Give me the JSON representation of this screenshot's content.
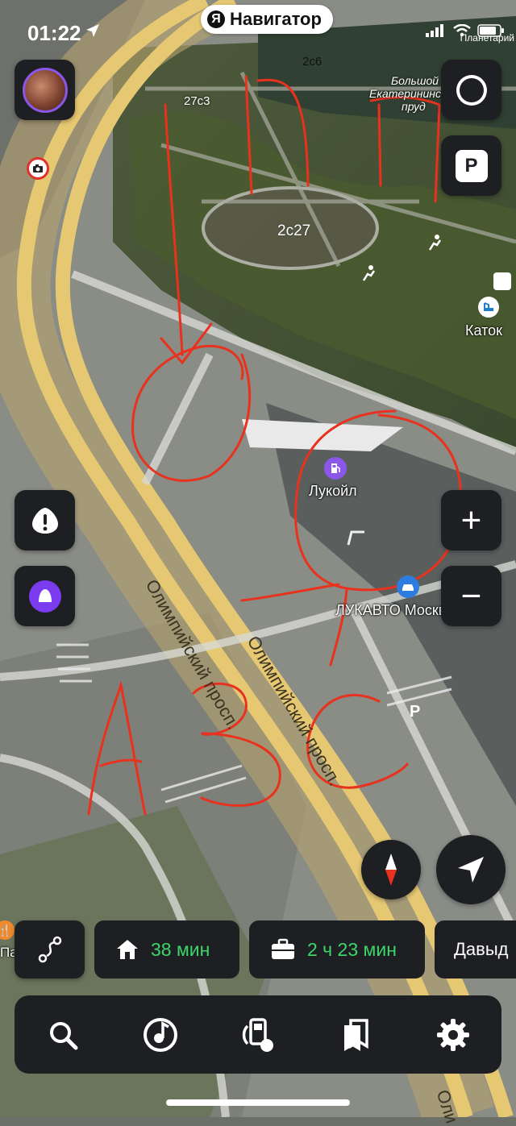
{
  "status_bar": {
    "time": "01:22",
    "carrier": "Планетарий"
  },
  "app": {
    "logo_letter": "Я",
    "title": "Навигатор"
  },
  "map": {
    "labels": {
      "building_27c3": "27с3",
      "building_2c6": "2с6",
      "building_2c27": "2с27",
      "pond_line1": "Большой",
      "pond_line2": "Екатерининс",
      "pond_line3": "пруд",
      "rink": "Каток",
      "gas_station": "Лукойл",
      "car_service": "ЛУКАВТО Москвич",
      "road_1": "Олимпийский просп.",
      "road_2": "Олимпийский просп.",
      "road_bottom": "Оли",
      "left_edge_poi": "Пате"
    },
    "annotations": {
      "letters": [
        "A",
        "B",
        "C"
      ],
      "color": "#e8321e"
    }
  },
  "controls": {
    "zoom_in": "+",
    "zoom_out": "−",
    "parking": "P"
  },
  "shortcuts": [
    {
      "icon": "home-icon",
      "time": "38 мин"
    },
    {
      "icon": "briefcase-icon",
      "time": "2 ч 23 мин"
    },
    {
      "name": "Давыд"
    }
  ],
  "tabbar": [
    "search-icon",
    "music-icon",
    "fuel-icon",
    "bookmarks-icon",
    "settings-icon"
  ],
  "colors": {
    "button_bg": "#1e1f22",
    "accent_green": "#3cd66a",
    "alice_purple": "#7b3cf0",
    "road_yellow": "#e6c873"
  }
}
